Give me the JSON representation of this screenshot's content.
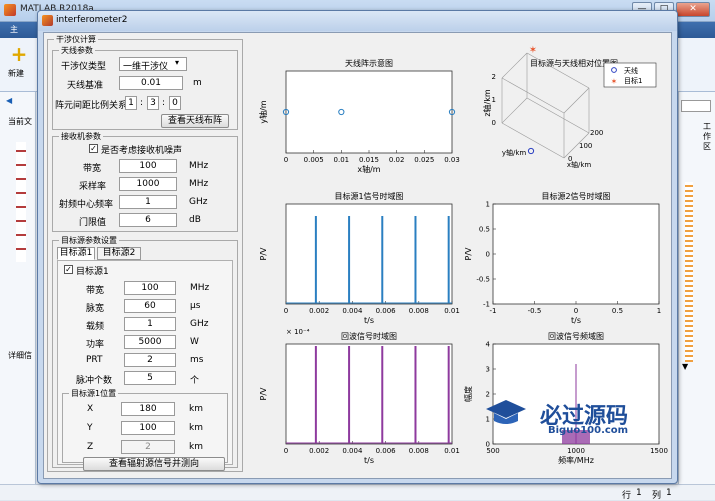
{
  "matlab": {
    "title": "MATLAB R2018a",
    "ribbon_tab": "主",
    "new_label": "新建",
    "left_labels": [
      "当前文",
      "详细信"
    ],
    "right_label": "工作区",
    "status_row": "行",
    "status_row_val": "1",
    "status_col": "列",
    "status_col_val": "1"
  },
  "window": {
    "title": "interferometer2",
    "minimize": "—",
    "maximize": "□",
    "close": "✕"
  },
  "panel_title": "干涉仪计算",
  "antenna": {
    "group_title": "天线参数",
    "type_label": "干涉仪类型",
    "type_value": "一维干涉仪",
    "baseline_label": "天线基准",
    "baseline_value": "0.01",
    "baseline_unit": "m",
    "ratio_label": "阵元间距比例关系",
    "ratio": [
      "1",
      "3",
      "0"
    ],
    "ratio_sep": ":",
    "layout_btn": "查看天线布阵"
  },
  "receiver": {
    "group_title": "接收机参数",
    "noise_chk": "是否考虑接收机噪声",
    "check_mark": "✓",
    "rows": [
      {
        "label": "带宽",
        "value": "100",
        "unit": "MHz"
      },
      {
        "label": "采样率",
        "value": "1000",
        "unit": "MHz"
      },
      {
        "label": "射频中心频率",
        "value": "1",
        "unit": "GHz"
      },
      {
        "label": "门限值",
        "value": "6",
        "unit": "dB"
      }
    ]
  },
  "target": {
    "group_title": "目标源参数设置",
    "tabs": [
      "目标源1",
      "目标源2"
    ],
    "enable_chk": "目标源1",
    "rows": [
      {
        "label": "带宽",
        "value": "100",
        "unit": "MHz"
      },
      {
        "label": "脉宽",
        "value": "60",
        "unit": "μs"
      },
      {
        "label": "载频",
        "value": "1",
        "unit": "GHz"
      },
      {
        "label": "功率",
        "value": "5000",
        "unit": "W"
      },
      {
        "label": "PRT",
        "value": "2",
        "unit": "ms"
      },
      {
        "label": "脉冲个数",
        "value": "5",
        "unit": "个"
      }
    ],
    "pos_title": "目标源1位置",
    "pos": [
      {
        "label": "X",
        "value": "180",
        "unit": "km"
      },
      {
        "label": "Y",
        "value": "100",
        "unit": "km"
      },
      {
        "label": "Z",
        "value": "2",
        "unit": "km"
      }
    ],
    "view_btn": "查看辐射源信号并测向"
  },
  "watermark": {
    "text": "必过源码",
    "url": "Biguo100.com"
  },
  "chart_data": [
    {
      "type": "scatter",
      "title": "天线阵示意图",
      "xlabel": "x轴/m",
      "ylabel": "y轴/m",
      "x": [
        0,
        0.01,
        0.03
      ],
      "y": [
        0,
        0,
        0
      ],
      "xlim": [
        0,
        0.03
      ],
      "xticks": [
        "0",
        "0.005",
        "0.01",
        "0.015",
        "0.02",
        "0.025",
        "0.03"
      ],
      "color": "#2a7fc1"
    },
    {
      "type": "scatter",
      "title": "目标源与天线相对位置图",
      "xlabel": "x轴/km",
      "ylabel": "y轴/km",
      "zlabel": "z轴/km",
      "series": [
        {
          "name": "天线",
          "x": [
            0
          ],
          "y": [
            0
          ],
          "z": [
            0
          ],
          "color": "#2a3fc1"
        },
        {
          "name": "目标1",
          "x": [
            180
          ],
          "y": [
            100
          ],
          "z": [
            2
          ],
          "color": "#e8542a"
        }
      ],
      "xticks": [
        "0",
        "100",
        "200"
      ],
      "yticks": [
        "0",
        "100",
        "200"
      ],
      "zticks": [
        "0",
        "1",
        "2"
      ],
      "legend": "top-right"
    },
    {
      "type": "line",
      "title": "目标源1信号时域图",
      "xlabel": "t/s",
      "ylabel": "P/V",
      "pulses_x": [
        0.0018,
        0.0038,
        0.0058,
        0.0078,
        0.0098
      ],
      "xticks": [
        "0",
        "0.002",
        "0.004",
        "0.006",
        "0.008",
        "0.01"
      ],
      "color": "#2a7fc1"
    },
    {
      "type": "line",
      "title": "目标源2信号时域图",
      "xlabel": "t/s",
      "ylabel": "P/V",
      "xticks": [
        "-1",
        "-0.5",
        "0",
        "0.5",
        "1"
      ],
      "yticks": [
        "-1",
        "-0.5",
        "0",
        "0.5",
        "1"
      ]
    },
    {
      "type": "line",
      "title": "回波信号时域图",
      "xlabel": "t/s",
      "ylabel": "P/V",
      "exponent": "× 10⁻⁴",
      "pulses_x": [
        0.0018,
        0.0038,
        0.0058,
        0.0078,
        0.0098
      ],
      "xticks": [
        "0",
        "0.002",
        "0.004",
        "0.006",
        "0.008",
        "0.01"
      ],
      "color": "#8e3a9e"
    },
    {
      "type": "bar",
      "title": "回波信号频域图",
      "xlabel": "频率/MHz",
      "ylabel": "幅度",
      "peak_x": 1000,
      "peak_y": 3.2,
      "xlim": [
        500,
        1500
      ],
      "ylim": [
        0,
        4
      ],
      "xticks": [
        "500",
        "1000",
        "1500"
      ],
      "yticks": [
        "0",
        "1",
        "2",
        "3",
        "4"
      ],
      "color": "#8e3a9e"
    }
  ]
}
